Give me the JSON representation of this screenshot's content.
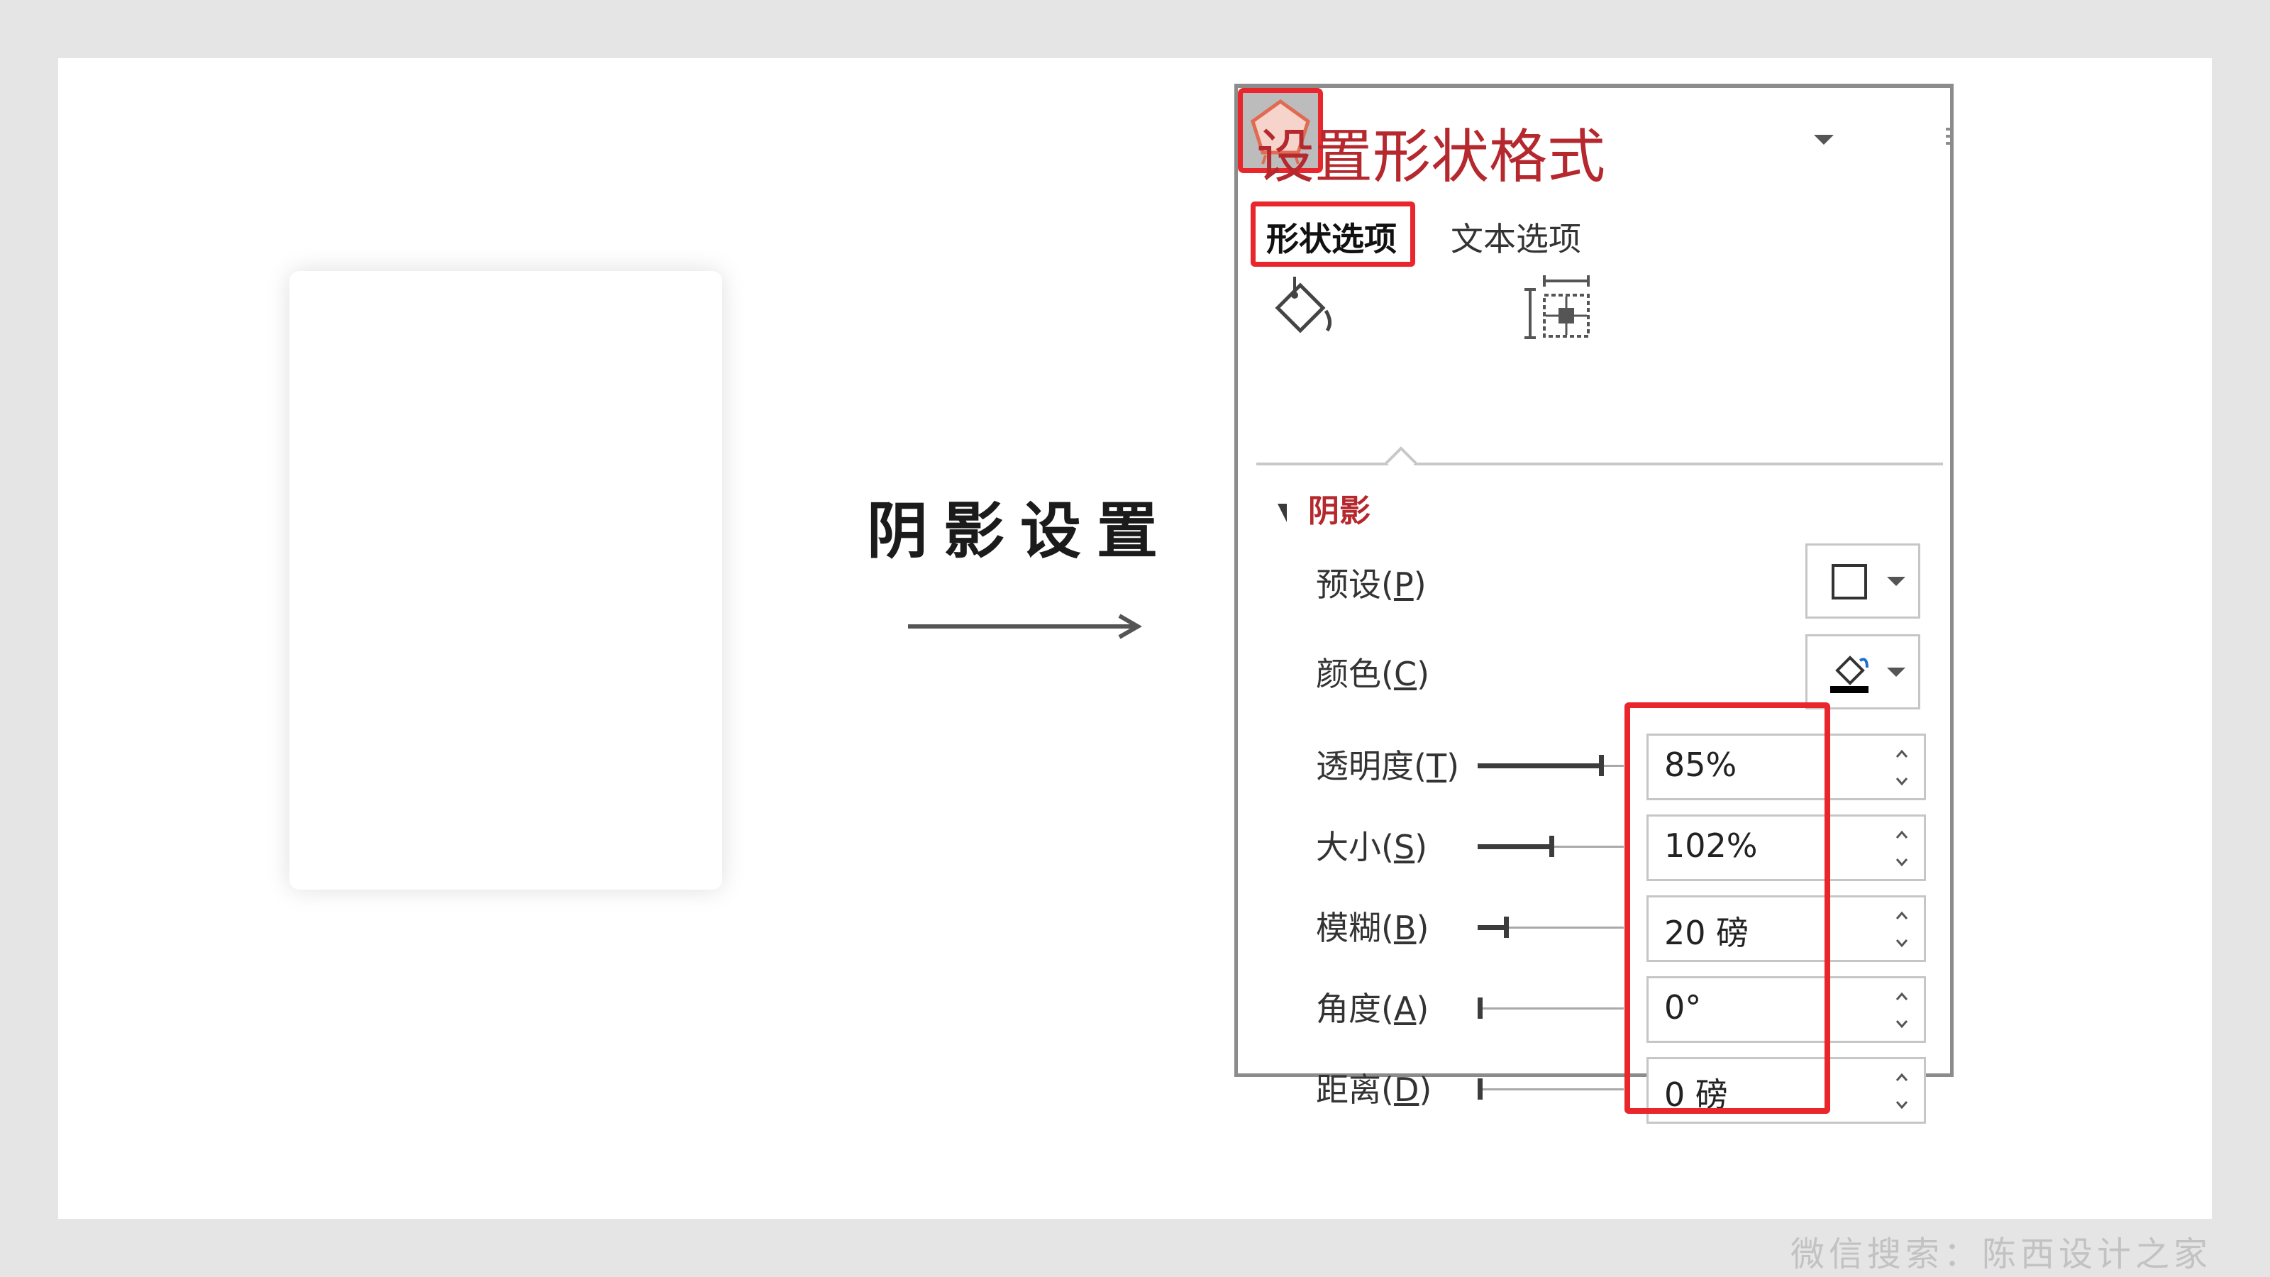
{
  "caption": "阴影设置",
  "panel": {
    "title": "设置形状格式",
    "tabs": {
      "shape_options": "形状选项",
      "text_options": "文本选项"
    },
    "category_icons": [
      "fill-line-icon",
      "effects-pentagon-icon",
      "size-properties-icon"
    ],
    "selected_category": "effects-pentagon-icon",
    "section": {
      "title": "阴影",
      "expanded": true
    },
    "preset": {
      "label": "预设(",
      "accel": "P",
      "suffix": ")"
    },
    "color": {
      "label": "颜色(",
      "accel": "C",
      "suffix": ")",
      "swatch": "#000000"
    },
    "rows": [
      {
        "label": "透明度(",
        "accel": "T",
        "suffix": ")",
        "value": "85%",
        "level": 0.85
      },
      {
        "label": "大小(",
        "accel": "S",
        "suffix": ")",
        "value": "102%",
        "level": 0.51
      },
      {
        "label": "模糊(",
        "accel": "B",
        "suffix": ")",
        "value": "20 磅",
        "level": 0.2
      },
      {
        "label": "角度(",
        "accel": "A",
        "suffix": ")",
        "value": "0°",
        "level": 0
      },
      {
        "label": "距离(",
        "accel": "D",
        "suffix": ")",
        "value": "0 磅",
        "level": 0
      }
    ]
  },
  "watermark": "微信搜索：陈西设计之家",
  "colors": {
    "accent_red": "#b5282d",
    "highlight_red": "#e8262c",
    "page_bg": "#e6e5e6"
  }
}
